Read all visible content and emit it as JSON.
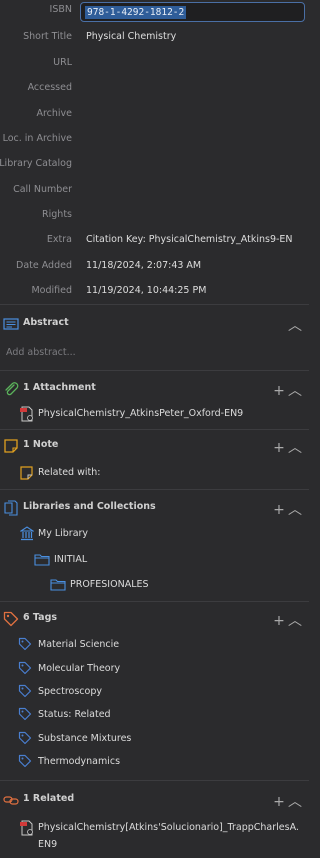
{
  "fields": [
    {
      "label": "ISBN",
      "value": "978-1-4292-1812-2"
    },
    {
      "label": "Short Title",
      "value": "Physical Chemistry"
    },
    {
      "label": "URL",
      "value": ""
    },
    {
      "label": "Accessed",
      "value": ""
    },
    {
      "label": "Archive",
      "value": ""
    },
    {
      "label": "Loc. in Archive",
      "value": ""
    },
    {
      "label": "Library Catalog",
      "value": ""
    },
    {
      "label": "Call Number",
      "value": ""
    },
    {
      "label": "Rights",
      "value": ""
    },
    {
      "label": "Extra",
      "value": "Citation Key: PhysicalChemistry_Atkins9-EN"
    },
    {
      "label": "Date Added",
      "value": "11/18/2024, 2:07:43 AM"
    },
    {
      "label": "Modified",
      "value": "11/19/2024, 10:44:25 PM"
    }
  ],
  "abstract": {
    "title": "Abstract",
    "placeholder": "Add abstract..."
  },
  "attachments": {
    "title": "1 Attachment",
    "items": [
      "PhysicalChemistry_AtkinsPeter_Oxford-EN9"
    ]
  },
  "notes": {
    "title": "1 Note",
    "items": [
      "Related with:"
    ]
  },
  "libraries": {
    "title": "Libraries and Collections",
    "library": "My Library",
    "collection": "INITIAL",
    "subcollection": "PROFESIONALES"
  },
  "tags": {
    "title": "6 Tags",
    "items": [
      "Material Sciencie",
      "Molecular Theory",
      "Spectroscopy",
      "Status: Related",
      "Substance Mixtures",
      "Thermodynamics"
    ]
  },
  "related": {
    "title": "1 Related",
    "line1": "PhysicalChemistry[Atkins'Solucionario]_TrappCharlesA.",
    "line2": "EN9"
  },
  "icons": {
    "add": "+",
    "collapse": "︿"
  },
  "colors": {
    "accent": "#4a8fe0",
    "tag": "#4a7fd0",
    "attach": "#5bb35b",
    "note": "#e0a020",
    "tagsec": "#e07040",
    "related": "#e07040"
  }
}
